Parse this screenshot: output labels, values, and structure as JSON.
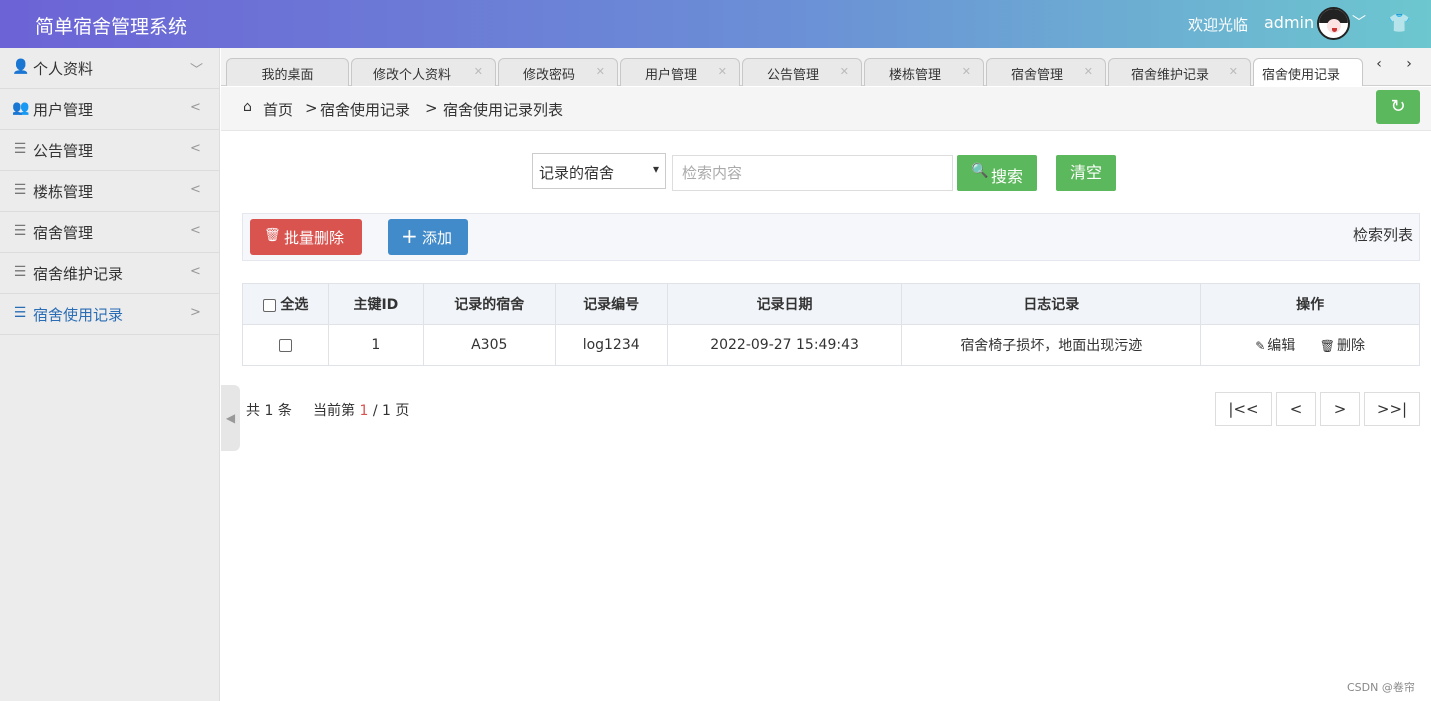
{
  "header": {
    "app_title": "简单宿舍管理系统",
    "welcome": "欢迎光临",
    "username": "admin"
  },
  "sidebar": {
    "items": [
      {
        "icon": "user-icon",
        "label": "个人资料",
        "arrow": "﹀"
      },
      {
        "icon": "users-icon",
        "label": "用户管理",
        "arrow": "<"
      },
      {
        "icon": "list-icon",
        "label": "公告管理",
        "arrow": "<"
      },
      {
        "icon": "list-icon",
        "label": "楼栋管理",
        "arrow": "<"
      },
      {
        "icon": "list-icon",
        "label": "宿舍管理",
        "arrow": "<"
      },
      {
        "icon": "list-icon",
        "label": "宿舍维护记录",
        "arrow": "<"
      },
      {
        "icon": "list-icon",
        "label": "宿舍使用记录",
        "arrow": ">"
      }
    ]
  },
  "tabs": [
    {
      "label": "我的桌面"
    },
    {
      "label": "修改个人资料"
    },
    {
      "label": "修改密码"
    },
    {
      "label": "用户管理"
    },
    {
      "label": "公告管理"
    },
    {
      "label": "楼栋管理"
    },
    {
      "label": "宿舍管理"
    },
    {
      "label": "宿舍维护记录"
    },
    {
      "label": "宿舍使用记录"
    }
  ],
  "breadcrumb": {
    "home": "首页",
    "sep": ">",
    "item1": "宿舍使用记录",
    "item2": "宿舍使用记录列表"
  },
  "search": {
    "field_selected": "记录的宿舍",
    "placeholder": "检索内容",
    "search_label": "搜索",
    "clear_label": "清空"
  },
  "toolbar": {
    "batch_delete_label": "批量删除",
    "add_label": "添加",
    "list_title": "检索列表"
  },
  "table": {
    "select_all_label": "全选",
    "columns": [
      "主键ID",
      "记录的宿舍",
      "记录编号",
      "记录日期",
      "日志记录",
      "操作"
    ],
    "rows": [
      {
        "id": "1",
        "dorm": "A305",
        "code": "log1234",
        "date": "2022-09-27 15:49:43",
        "log": "宿舍椅子损坏，地面出现污迹",
        "edit_label": "编辑",
        "delete_label": "删除"
      }
    ]
  },
  "pagination": {
    "total_prefix": "共",
    "total": "1",
    "total_suffix": "条",
    "current_prefix": "当前第",
    "current": "1",
    "pages": "/ 1 页",
    "first": "|<<",
    "prev": "<",
    "next": ">",
    "last": ">>|"
  },
  "watermark": "CSDN @卷帘",
  "colors": {
    "primary_green": "#5cb85c",
    "danger_red": "#d9534f",
    "primary_blue": "#428bca"
  }
}
